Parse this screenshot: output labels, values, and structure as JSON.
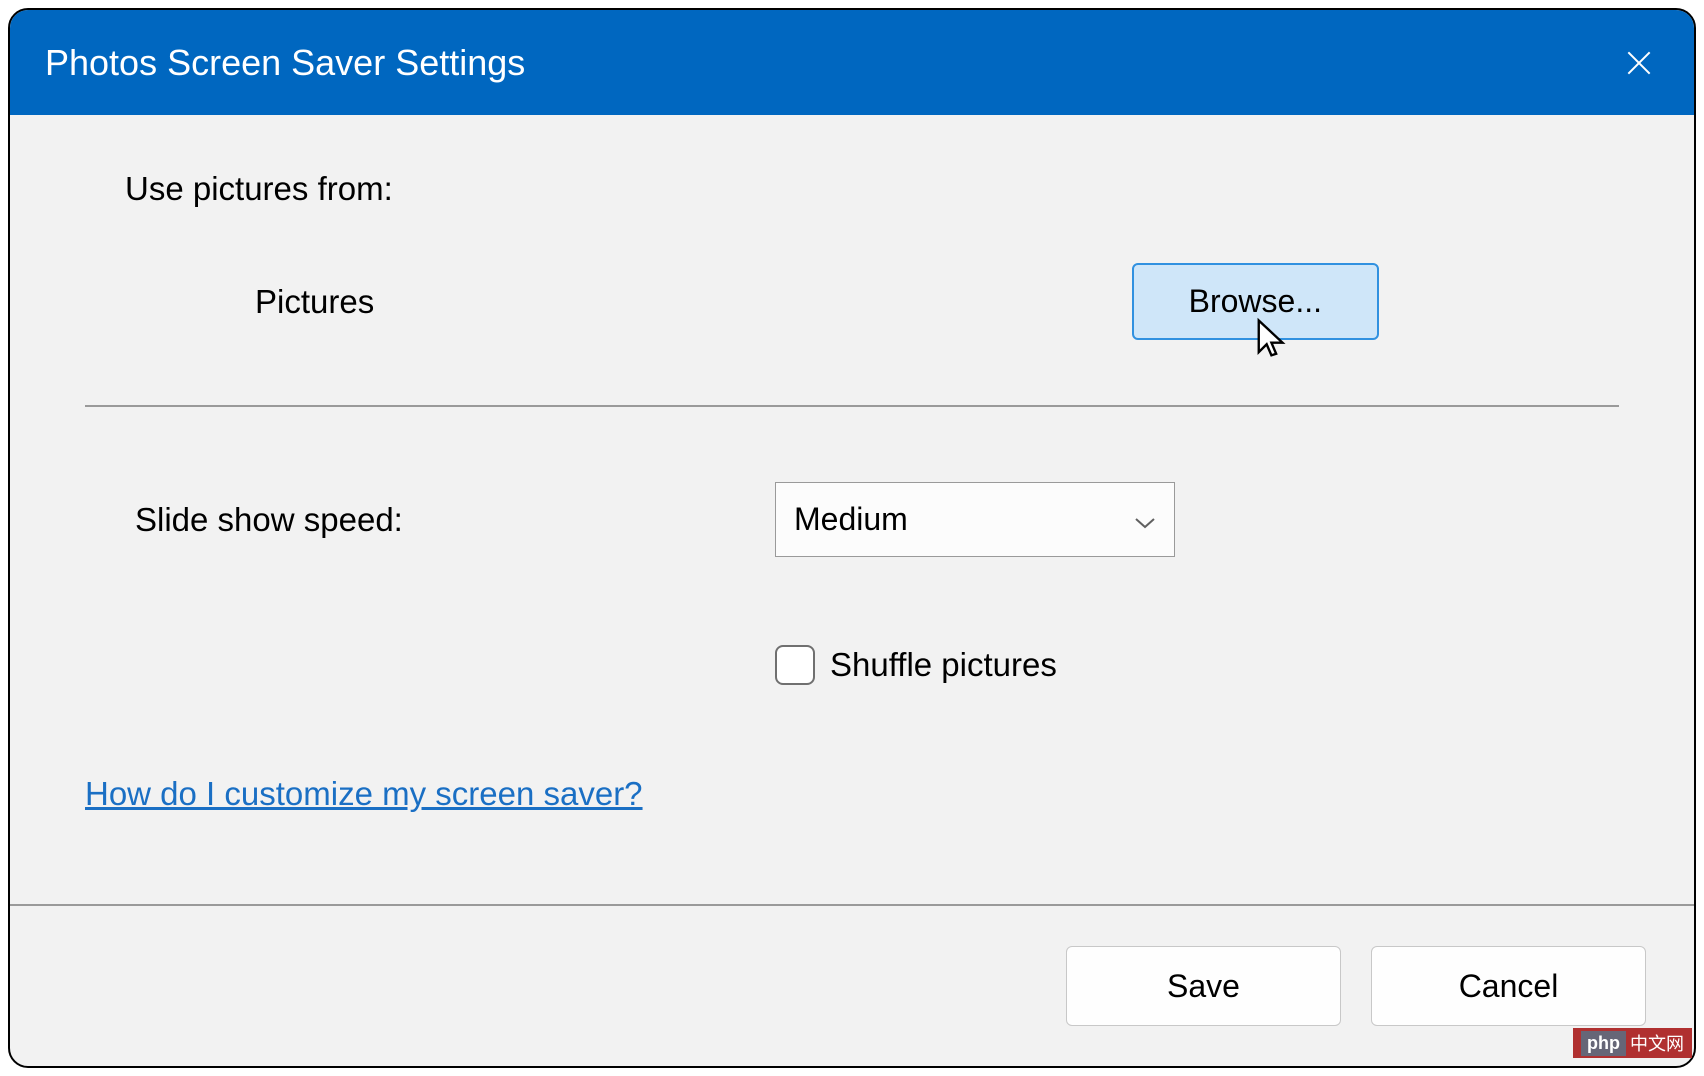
{
  "titlebar": {
    "title": "Photos Screen Saver Settings"
  },
  "content": {
    "use_pictures_label": "Use pictures from:",
    "pictures_folder": "Pictures",
    "browse_label": "Browse...",
    "speed_label": "Slide show speed:",
    "speed_value": "Medium",
    "shuffle_label": "Shuffle pictures",
    "shuffle_checked": false,
    "help_link": "How do I customize my screen saver?"
  },
  "footer": {
    "save_label": "Save",
    "cancel_label": "Cancel"
  },
  "watermark": {
    "prefix": "php",
    "suffix": "中文网"
  }
}
